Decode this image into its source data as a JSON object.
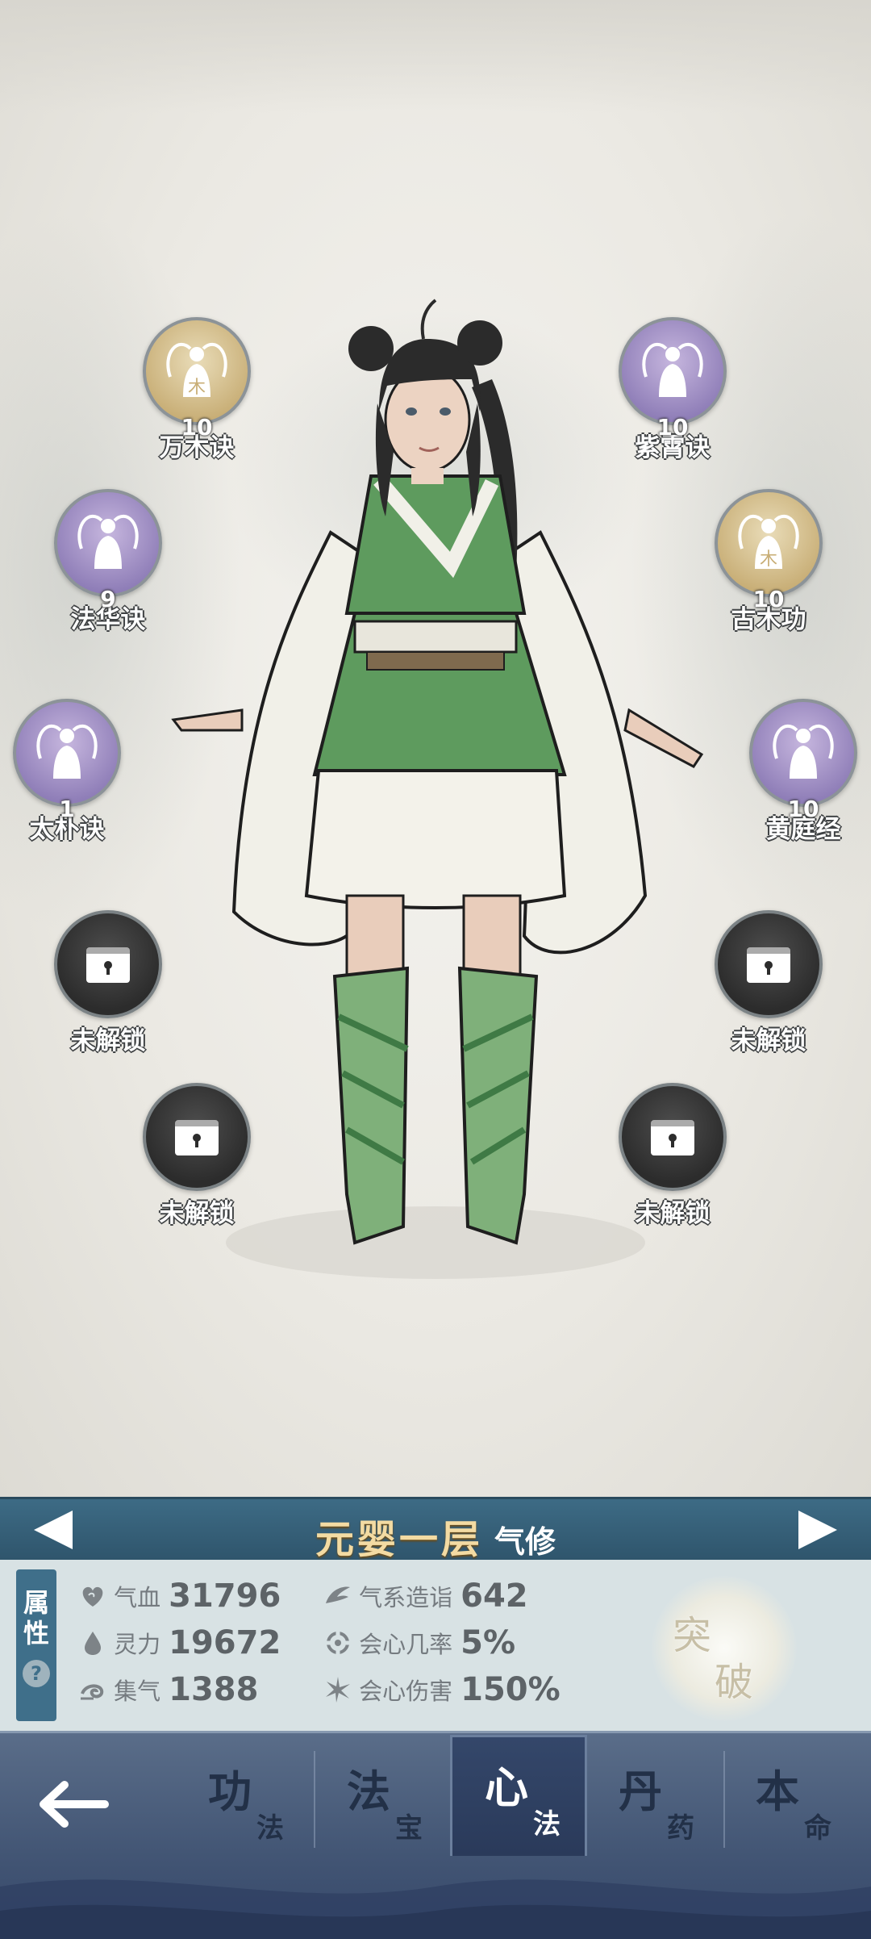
{
  "skill_nodes": [
    {
      "name": "万木诀",
      "level": "10",
      "style": "gold",
      "icon": "meditating-figure-icon"
    },
    {
      "name": "紫霄诀",
      "level": "10",
      "style": "purple",
      "icon": "meditating-figure-icon"
    },
    {
      "name": "法华诀",
      "level": "9",
      "style": "purple",
      "icon": "meditating-figure-icon"
    },
    {
      "name": "古木功",
      "level": "10",
      "style": "gold",
      "icon": "meditating-figure-icon"
    },
    {
      "name": "太朴诀",
      "level": "1",
      "style": "purple",
      "icon": "meditating-figure-icon"
    },
    {
      "name": "黄庭经",
      "level": "10",
      "style": "purple",
      "icon": "meditating-figure-icon"
    }
  ],
  "locked_nodes": [
    {
      "name": "未解锁",
      "icon": "lock-icon"
    },
    {
      "name": "未解锁",
      "icon": "lock-icon"
    },
    {
      "name": "未解锁",
      "icon": "lock-icon"
    },
    {
      "name": "未解锁",
      "icon": "lock-icon"
    }
  ],
  "realm": {
    "name": "元婴一层",
    "type": "气修"
  },
  "attributes": {
    "tab_label": "属性",
    "help": "?",
    "items": [
      {
        "label": "气血",
        "value": "31796",
        "icon": "heart-swirl-icon"
      },
      {
        "label": "灵力",
        "value": "19672",
        "icon": "water-drop-icon"
      },
      {
        "label": "集气",
        "value": "1388",
        "icon": "wind-swirl-icon"
      },
      {
        "label": "气系造诣",
        "value": "642",
        "icon": "wind-wing-icon"
      },
      {
        "label": "会心几率",
        "value": "5%",
        "icon": "crit-rate-icon"
      },
      {
        "label": "会心伤害",
        "value": "150%",
        "icon": "crit-damage-icon"
      }
    ]
  },
  "breakthrough": {
    "char1": "突",
    "char2": "破"
  },
  "nav": {
    "back_icon": "back-arrow-icon",
    "tabs": [
      {
        "big": "功",
        "small": "法",
        "active": false
      },
      {
        "big": "法",
        "small": "宝",
        "active": false
      },
      {
        "big": "心",
        "small": "法",
        "active": true
      },
      {
        "big": "丹",
        "small": "药",
        "active": false
      },
      {
        "big": "本",
        "small": "命",
        "active": false
      }
    ]
  },
  "colors": {
    "realm_bar": "#36607a",
    "realm_name": "#f3dba3",
    "stats_bg": "#d8e2e4",
    "nav_bg": "#425574",
    "orb_gold": "#c8ae76",
    "orb_purple": "#8e7db7",
    "orb_locked": "#2c2c2c"
  }
}
